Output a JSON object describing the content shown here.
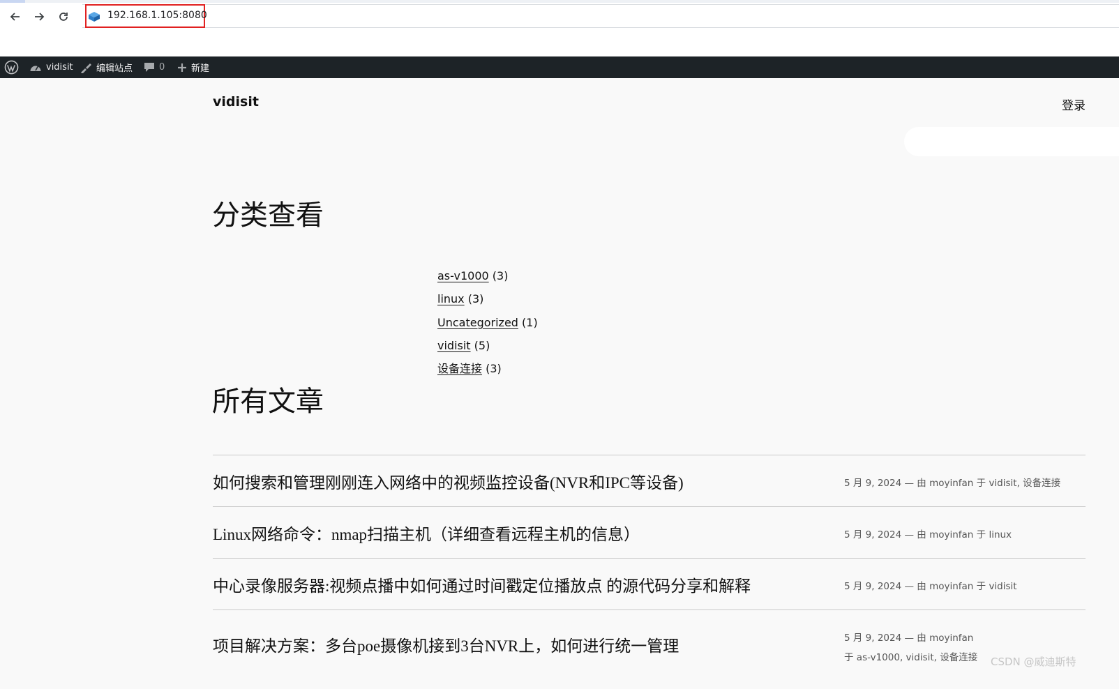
{
  "browser": {
    "url": "192.168.1.105:8080"
  },
  "admin_bar": {
    "site_name": "vidisit",
    "edit_site": "编辑站点",
    "comments_count": "0",
    "new_label": "新建"
  },
  "header": {
    "site_title": "vidisit",
    "login": "登录"
  },
  "categories": {
    "heading": "分类查看",
    "items": [
      {
        "name": "as-v1000",
        "count": "(3)"
      },
      {
        "name": "linux",
        "count": "(3)"
      },
      {
        "name": "Uncategorized",
        "count": "(1)"
      },
      {
        "name": "vidisit",
        "count": "(5)"
      },
      {
        "name": "设备连接",
        "count": "(3)"
      }
    ]
  },
  "posts": {
    "heading": "所有文章",
    "items": [
      {
        "title": "如何搜索和管理刚刚连入网络中的视频监控设备(NVR和IPC等设备)",
        "meta_line1": "5 月 9, 2024 — 由 moyinfan 于 vidisit, 设备连接",
        "meta_line2": ""
      },
      {
        "title": "Linux网络命令：nmap扫描主机（详细查看远程主机的信息）",
        "meta_line1": "5 月 9, 2024 — 由 moyinfan 于 linux",
        "meta_line2": ""
      },
      {
        "title": "中心录像服务器:视频点播中如何通过时间戳定位播放点 的源代码分享和解释",
        "meta_line1": "5 月 9, 2024 — 由 moyinfan 于 vidisit",
        "meta_line2": ""
      },
      {
        "title": "项目解决方案：多台poe摄像机接到3台NVR上，如何进行统一管理",
        "meta_line1": "5 月 9, 2024 — 由 moyinfan",
        "meta_line2": "于 as-v1000, vidisit, 设备连接"
      }
    ]
  },
  "watermark": "CSDN @威迪斯特"
}
